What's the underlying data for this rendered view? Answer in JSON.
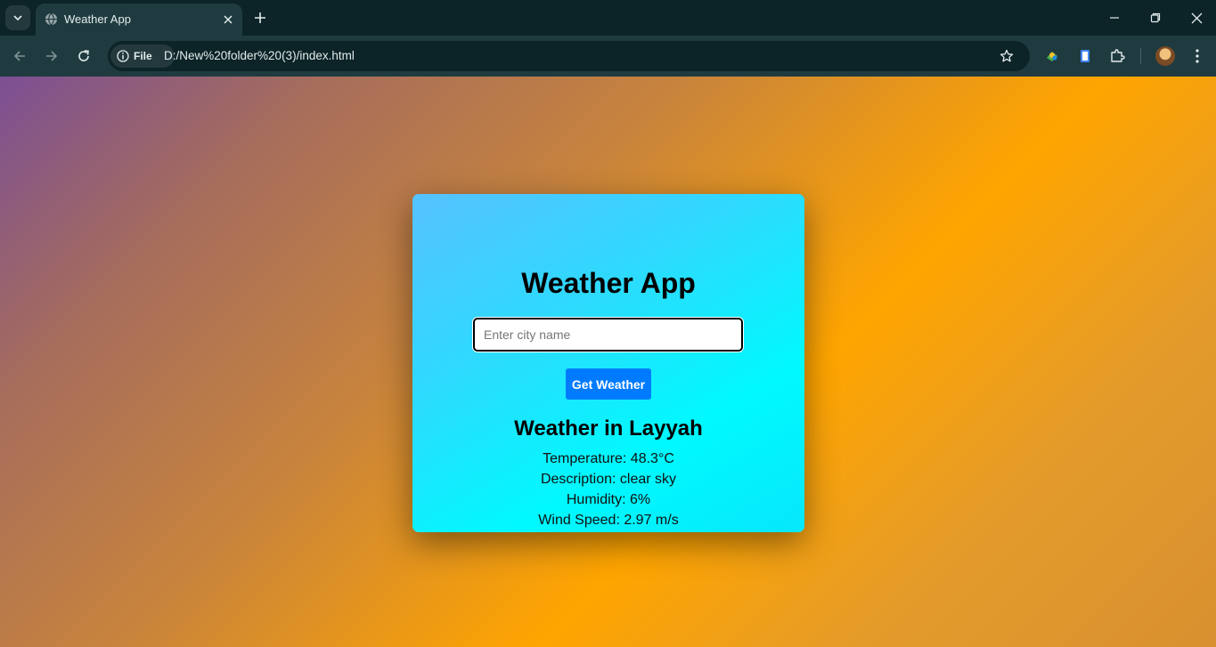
{
  "browser": {
    "tab": {
      "title": "Weather App"
    },
    "site_chip_label": "File",
    "url": "D:/New%20folder%20(3)/index.html"
  },
  "page": {
    "title": "Weather App",
    "search": {
      "placeholder": "Enter city name",
      "value": ""
    },
    "button_label": "Get Weather",
    "result": {
      "heading": "Weather in Layyah",
      "temperature": "Temperature: 48.3°C",
      "description": "Description: clear sky",
      "humidity": "Humidity: 6%",
      "wind": "Wind Speed: 2.97 m/s"
    }
  },
  "colors": {
    "button": "#007bff",
    "card_gradient_start": "#56c1fe",
    "card_gradient_end": "#00f9fe",
    "background_orange": "#ffa500",
    "background_purple": "#7c4f94"
  },
  "icons": [
    "tab-search-icon",
    "globe-icon",
    "close-icon",
    "plus-icon",
    "minimize-icon",
    "restore-icon",
    "window-close-icon",
    "back-arrow-icon",
    "forward-arrow-icon",
    "reload-icon",
    "info-icon",
    "star-icon",
    "extension-color-icon",
    "extension-doc-icon",
    "puzzle-icon",
    "kebab-menu-icon"
  ]
}
